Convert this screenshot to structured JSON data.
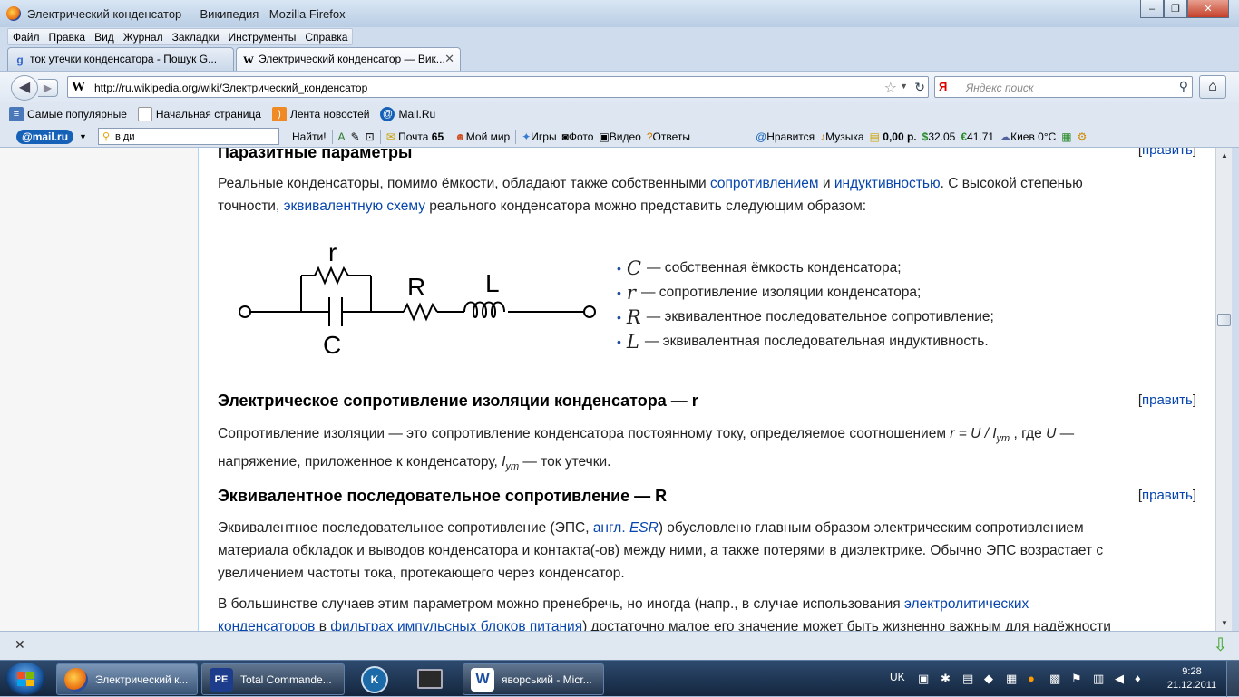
{
  "window": {
    "title": "Электрический конденсатор — Википедия - Mozilla Firefox",
    "minimize": "‒",
    "maximize": "❐",
    "close": "✕"
  },
  "menu": [
    "Файл",
    "Правка",
    "Вид",
    "Журнал",
    "Закладки",
    "Инструменты",
    "Справка"
  ],
  "tabs": [
    {
      "label": "ток утечки конденсатора - Пошук G...",
      "icon": "google-icon"
    },
    {
      "label": "Электрический конденсатор — Вик...",
      "icon": "wikipedia-icon"
    }
  ],
  "new_tab": "+",
  "nav": {
    "url": "http://ru.wikipedia.org/wiki/Электрический_конденсатор",
    "search_placeholder": "Яндекс поиск",
    "search_engine_badge": "Я",
    "site_badge": "W"
  },
  "bookmarks": [
    {
      "label": "Самые популярные",
      "icon": "bookmarks-icon"
    },
    {
      "label": "Начальная страница",
      "icon": "page-icon"
    },
    {
      "label": "Лента новостей",
      "icon": "rss-icon"
    },
    {
      "label": "Mail.Ru",
      "icon": "mailru-icon"
    }
  ],
  "mailbar": {
    "logo": "@mail.ru",
    "search_value": "в ди",
    "find": "Найти!",
    "mail_label": "Почта",
    "mail_count": "65",
    "my_world": "Мой мир",
    "games": "Игры",
    "photo": "Фото",
    "video": "Видео",
    "answers": "Ответы",
    "likes": "Нравится",
    "music": "Музыка",
    "balance": "0,00 р.",
    "usd": "32.05",
    "eur": "41.71",
    "weather": "Киев 0°C"
  },
  "article": {
    "section_title": "Паразитные параметры",
    "intro_1": "Реальные конденсаторы, помимо ёмкости, обладают также собственными ",
    "link_resistance": "сопротивлением",
    "intro_2": " и ",
    "link_inductance": "индуктивностью",
    "intro_3": ". С высокой степенью",
    "intro_4": "точности, ",
    "link_equiv": "эквивалентную схему",
    "intro_5": " реального конденсатора можно представить следующим образом:",
    "circuit_labels": {
      "r": "r",
      "R": "R",
      "L": "L",
      "C": "C"
    },
    "legend": [
      {
        "sym": "C",
        "text": "— собственная ёмкость конденсатора;"
      },
      {
        "sym": "r",
        "text": "— сопротивление изоляции конденсатора;"
      },
      {
        "sym": "R",
        "text": "— эквивалентное последовательное сопротивление;"
      },
      {
        "sym": "L",
        "text": "— эквивалентная последовательная индуктивность."
      }
    ],
    "edit_label": "править",
    "h2": "Электрическое сопротивление изоляции конденсатора — r",
    "p2_a": "Сопротивление изоляции — это сопротивление конденсатора постоянному току, определяемое соотношением ",
    "p2_formula": "r = U / I",
    "p2_sub": "ут",
    "p2_b": " , где ",
    "p2_U": "U",
    "p2_c": " —",
    "p2_d": "напряжение, приложенное к конденсатору, ",
    "p2_I": "I",
    "p2_sub2": "ут",
    "p2_e": " — ток утечки.",
    "h3": "Эквивалентное последовательное сопротивление — R",
    "p3_a": "Эквивалентное последовательное сопротивление (ЭПС, ",
    "p3_link": "англ.",
    "p3_esr": "ESR",
    "p3_b": ") обусловлено главным образом электрическим сопротивлением",
    "p3_c": "материала обкладок и выводов конденсатора и контакта(-ов) между ними, а также потерями в диэлектрике. Обычно ЭПС возрастает с",
    "p3_d": "увеличением частоты тока, протекающего через конденсатор.",
    "p4_a": "В большинстве случаев этим параметром можно пренебречь, но иногда (напр., в случае использования ",
    "p4_link1": "электролитических",
    "p4_link1b": "конденсаторов",
    "p4_b": " в ",
    "p4_link2": "фильтрах импульсных блоков питания",
    "p4_c": ") достаточно малое его значение может быть жизненно важным для надёжности"
  },
  "findbar": {
    "close": "✕"
  },
  "taskbar": {
    "items": [
      {
        "label": "Электрический к...",
        "active": true
      },
      {
        "label": "Total Commande...",
        "active": false
      },
      {
        "label": "яворський - Micr...",
        "active": false
      }
    ],
    "lang": "UK",
    "time": "9:28",
    "date": "21.12.2011"
  }
}
